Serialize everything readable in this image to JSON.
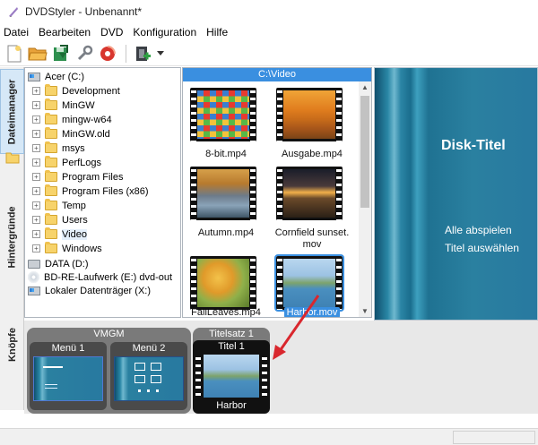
{
  "window": {
    "title": "DVDStyler - Unbenannt*"
  },
  "menu": [
    "Datei",
    "Bearbeiten",
    "DVD",
    "Konfiguration",
    "Hilfe"
  ],
  "toolbar": {
    "buttons": [
      "new-icon",
      "open-icon",
      "save-icon",
      "settings-icon",
      "burn-icon",
      "add-file-icon"
    ],
    "dropdown": "chevron-down-icon"
  },
  "tabs": [
    "Dateimanager",
    "Hintergründe",
    "Knöpfe"
  ],
  "tree": {
    "root": "Acer (C:)",
    "folders": [
      "Development",
      "MinGW",
      "mingw-w64",
      "MinGW.old",
      "msys",
      "PerfLogs",
      "Program Files",
      "Program Files (x86)",
      "Temp",
      "Users",
      "Video",
      "Windows"
    ],
    "drives": [
      "DATA (D:)",
      "BD-RE-Laufwerk (E:) dvd-out",
      "Lokaler Datenträger (X:)"
    ]
  },
  "files": {
    "path": "C:\\Video",
    "items": [
      {
        "name": "8-bit.mp4"
      },
      {
        "name": "Ausgabe.mp4"
      },
      {
        "name": "Autumn.mp4"
      },
      {
        "name": "Cornfield sunset.",
        "name2": "mov"
      },
      {
        "name": "FallLeaves.mp4"
      },
      {
        "name": "Harbor.mov",
        "selected": true
      }
    ]
  },
  "preview": {
    "title": "Disk-Titel",
    "options": [
      "Alle abspielen",
      "Titel auswählen"
    ]
  },
  "vmgm": {
    "label": "VMGM",
    "menus": [
      "Menü 1",
      "Menü 2"
    ]
  },
  "titleset": {
    "label": "Titelsatz 1",
    "title": "Titel 1",
    "caption": "Harbor"
  },
  "colors": {
    "accent": "#3a8fe0",
    "arrow": "#d9272e"
  }
}
